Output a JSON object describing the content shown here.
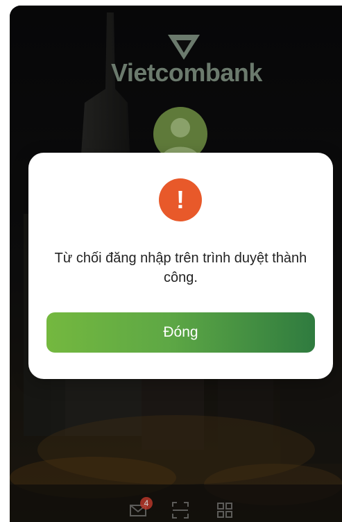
{
  "app": {
    "brand_name": "Vietcombank"
  },
  "dialog": {
    "message": "Từ chối đăng nhập trên trình duyệt thành công.",
    "alert_symbol": "!",
    "close_label": "Đóng",
    "accent_color": "#e8592a"
  },
  "bottom_nav": {
    "mail_badge_count": "4",
    "items": [
      {
        "icon": "mail-icon"
      },
      {
        "icon": "qr-scan-icon"
      },
      {
        "icon": "grid-menu-icon"
      }
    ]
  },
  "colors": {
    "button_gradient_start": "#74b83f",
    "button_gradient_end": "#2f7b3f",
    "alert_icon_bg": "#e8592a"
  }
}
